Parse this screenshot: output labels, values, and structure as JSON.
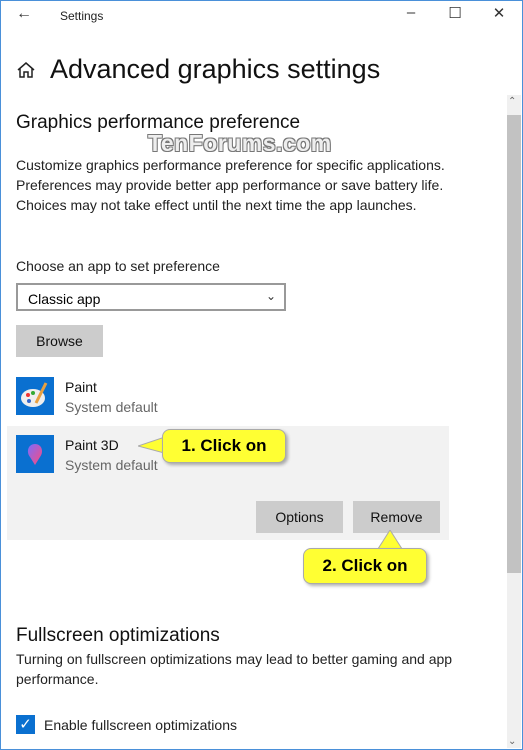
{
  "window": {
    "title": "Settings",
    "back_icon": "arrow-left-icon",
    "controls": [
      "minimize-icon",
      "maximize-icon",
      "close-icon"
    ]
  },
  "page": {
    "title": "Advanced graphics settings",
    "home_icon": "home-icon"
  },
  "graphics": {
    "heading": "Graphics performance preference",
    "description": "Customize graphics performance preference for specific applications. Preferences may provide better app performance or save battery life. Choices may not take effect until the next time the app launches.",
    "choose_label": "Choose an app to set preference",
    "select_value": "Classic app",
    "browse_label": "Browse",
    "apps": [
      {
        "name": "Paint",
        "status": "System default"
      },
      {
        "name": "Paint 3D",
        "status": "System default"
      }
    ],
    "options_label": "Options",
    "remove_label": "Remove"
  },
  "callouts": {
    "first": "1. Click on",
    "second": "2. Click on"
  },
  "watermark": "TenForums.com",
  "fullscreen": {
    "heading": "Fullscreen optimizations",
    "description": "Turning on fullscreen optimizations may lead to better gaming and app performance.",
    "checkbox_label": "Enable fullscreen optimizations",
    "checked": true
  },
  "colors": {
    "accent": "#0a70d0",
    "callout": "#ffff33"
  }
}
